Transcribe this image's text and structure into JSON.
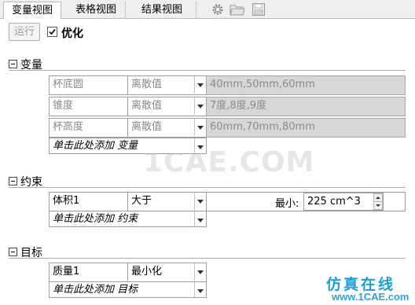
{
  "tabs": [
    {
      "label": "变量视图"
    },
    {
      "label": "表格视图"
    },
    {
      "label": "结果视图"
    }
  ],
  "toolbar": {
    "run_label": "运行",
    "optimize_label": "优化",
    "optimize_checked": true
  },
  "sections": {
    "variables": {
      "title": "变量",
      "rows": [
        {
          "name": "杯底圆",
          "type": "离散值",
          "values": "40mm,50mm,60mm"
        },
        {
          "name": "锥度",
          "type": "离散值",
          "values": "7度,8度,9度"
        },
        {
          "name": "杯高度",
          "type": "离散值",
          "values": "60mm,70mm,80mm"
        }
      ],
      "add_label": "单击此处添加 变量"
    },
    "constraints": {
      "title": "约束",
      "row": {
        "name": "体积1",
        "type": "大于",
        "min_label": "最小:",
        "min_value": "225 cm^3"
      },
      "add_label": "单击此处添加 约束"
    },
    "goals": {
      "title": "目标",
      "row": {
        "name": "质量1",
        "type": "最小化"
      },
      "add_label": "单击此处添加 目标"
    }
  },
  "watermark": "1CAE.COM",
  "branding": {
    "line1": "仿真在线",
    "line2": "www.1CAE.com"
  }
}
